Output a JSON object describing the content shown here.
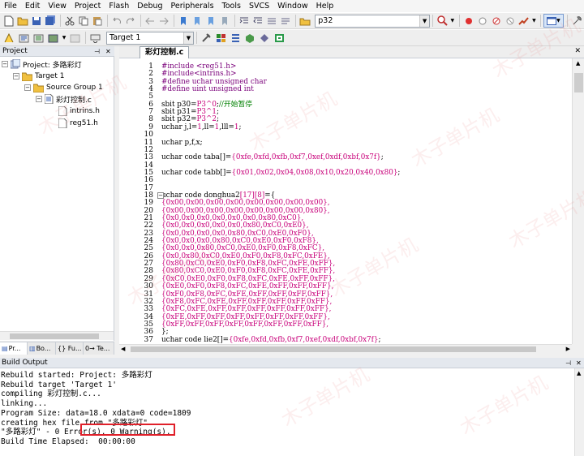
{
  "menubar": {
    "items": [
      "File",
      "Edit",
      "View",
      "Project",
      "Flash",
      "Debug",
      "Peripherals",
      "Tools",
      "SVCS",
      "Window",
      "Help"
    ]
  },
  "toolbar": {
    "find_value": "p32",
    "target_value": "Target 1"
  },
  "project_panel": {
    "title": "Project",
    "tree": {
      "root": "Project: 多路彩灯",
      "target": "Target 1",
      "group": "Source Group 1",
      "file": "彩灯控制.c",
      "headers": [
        "intrins.h",
        "reg51.h"
      ]
    },
    "tabs": [
      "Pr...",
      "Bo...",
      "{} Fu...",
      "0→ Te..."
    ]
  },
  "editor": {
    "tab_label": "彩灯控制.c",
    "lines": [
      {
        "n": "1",
        "t": "#include <reg51.h>",
        "c": "pp"
      },
      {
        "n": "2",
        "t": "#include<intrins.h>",
        "c": "pp"
      },
      {
        "n": "3",
        "t": "#define uchar unsigned char",
        "c": "pp"
      },
      {
        "n": "4",
        "t": "#define uint unsigned int",
        "c": "pp"
      },
      {
        "n": "5",
        "t": "",
        "c": ""
      },
      {
        "n": "6",
        "t": "sbit p30=P3^0;//开始暂停",
        "c": "mix1"
      },
      {
        "n": "7",
        "t": "sbit p31=P3^1;",
        "c": "mix2"
      },
      {
        "n": "8",
        "t": "sbit p32=P3^2;",
        "c": "mix2"
      },
      {
        "n": "9",
        "t": "uchar j,l=1,ll=1,lll=1;",
        "c": "mix3"
      },
      {
        "n": "10",
        "t": "",
        "c": ""
      },
      {
        "n": "11",
        "t": "uchar p,f,x;",
        "c": ""
      },
      {
        "n": "12",
        "t": "",
        "c": ""
      },
      {
        "n": "13",
        "t": "uchar code taba[]={0xfe,0xfd,0xfb,0xf7,0xef,0xdf,0xbf,0x7f};",
        "c": "arr"
      },
      {
        "n": "14",
        "t": "",
        "c": ""
      },
      {
        "n": "15",
        "t": "uchar code tabb[]={0x01,0x02,0x04,0x08,0x10,0x20,0x40,0x80};",
        "c": "arr"
      },
      {
        "n": "16",
        "t": "",
        "c": ""
      },
      {
        "n": "17",
        "t": "",
        "c": ""
      },
      {
        "n": "18",
        "t": "uchar code donghua2[17][8]={",
        "c": "mix4"
      },
      {
        "n": "19",
        "t": "{0x00,0x00,0x00,0x00,0x00,0x00,0x00,0x00},",
        "c": "num"
      },
      {
        "n": "20",
        "t": "{0x00,0x00,0x00,0x00,0x00,0x00,0x00,0x80},",
        "c": "num"
      },
      {
        "n": "21",
        "t": "{0x0,0x0,0x0,0x0,0x0,0x0,0x80,0xC0},",
        "c": "num"
      },
      {
        "n": "22",
        "t": "{0x0,0x0,0x0,0x0,0x0,0x80,0xC0,0xE0},",
        "c": "num"
      },
      {
        "n": "23",
        "t": "{0x0,0x0,0x0,0x0,0x80,0xC0,0xE0,0xF0},",
        "c": "num"
      },
      {
        "n": "24",
        "t": "{0x0,0x0,0x0,0x80,0xC0,0xE0,0xF0,0xF8},",
        "c": "num"
      },
      {
        "n": "25",
        "t": "{0x0,0x0,0x80,0xC0,0xE0,0xF0,0xF8,0xFC},",
        "c": "num"
      },
      {
        "n": "26",
        "t": "{0x0,0x80,0xC0,0xE0,0xF0,0xF8,0xFC,0xFE},",
        "c": "num"
      },
      {
        "n": "27",
        "t": "{0x80,0xC0,0xE0,0xF0,0xF8,0xFC,0xFE,0xFF},",
        "c": "num"
      },
      {
        "n": "28",
        "t": "{0x80,0xC0,0xE0,0xF0,0xF8,0xFC,0xFE,0xFF},",
        "c": "num"
      },
      {
        "n": "29",
        "t": "{0xC0,0xE0,0xF0,0xF8,0xFC,0xFE,0xFF,0xFF},",
        "c": "num"
      },
      {
        "n": "30",
        "t": "{0xE0,0xF0,0xF8,0xFC,0xFE,0xFF,0xFF,0xFF},",
        "c": "num"
      },
      {
        "n": "31",
        "t": "{0xF0,0xF8,0xFC,0xFE,0xFF,0xFF,0xFF,0xFF},",
        "c": "num"
      },
      {
        "n": "32",
        "t": "{0xF8,0xFC,0xFE,0xFF,0xFF,0xFF,0xFF,0xFF},",
        "c": "num"
      },
      {
        "n": "33",
        "t": "{0xFC,0xFE,0xFF,0xFF,0xFF,0xFF,0xFF,0xFF},",
        "c": "num"
      },
      {
        "n": "34",
        "t": "{0xFE,0xFF,0xFF,0xFF,0xFF,0xFF,0xFF,0xFF},",
        "c": "num"
      },
      {
        "n": "35",
        "t": "{0xFF,0xFF,0xFF,0xFF,0xFF,0xFF,0xFF,0xFF},",
        "c": "num"
      },
      {
        "n": "36",
        "t": "};",
        "c": ""
      },
      {
        "n": "37",
        "t": "uchar code lie2[]={0xfe,0xfd,0xfb,0xf7,0xef,0xdf,0xbf,0x7f};",
        "c": "arr"
      }
    ]
  },
  "build_output": {
    "title": "Build Output",
    "lines": [
      "Rebuild started: Project: 多路彩灯",
      "Rebuild target 'Target 1'",
      "compiling 彩灯控制.c...",
      "linking...",
      "Program Size: data=18.0 xdata=0 code=1809",
      "creating hex file from \"多路彩灯\"...",
      "\"多路彩灯\" - 0 Error(s), 0 Warning(s).",
      "Build Time Elapsed:  00:00:00"
    ]
  },
  "watermark_text": "木子单片机"
}
